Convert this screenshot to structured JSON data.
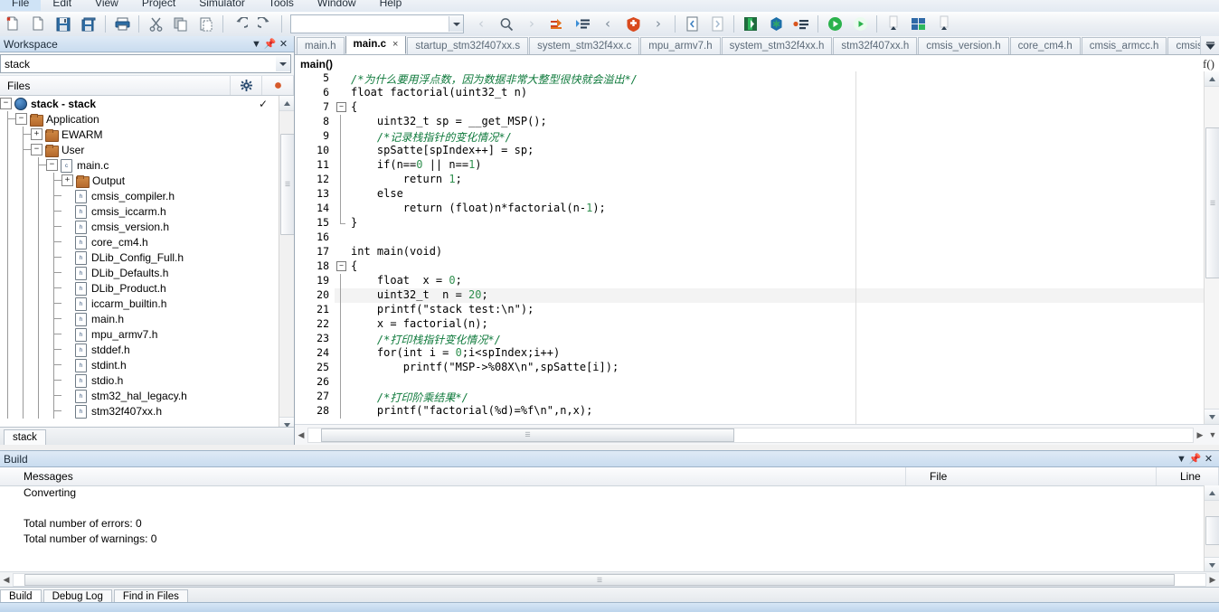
{
  "menu": {
    "items": [
      "File",
      "Edit",
      "View",
      "Project",
      "Simulator",
      "Tools",
      "Window",
      "Help"
    ]
  },
  "toolbar": {
    "combo_value": "",
    "buttons": [
      "new-document",
      "open-document",
      "save",
      "save-all",
      "print",
      "cut",
      "copy",
      "paste",
      "undo",
      "redo",
      "navigate-back",
      "find",
      "navigate-forward",
      "toggle-breakpoint",
      "bookmark",
      "previous-bookmark",
      "stop-build",
      "next-bookmark",
      "compile",
      "make",
      "download-and-debug",
      "debug-without-download",
      "make-and-restart",
      "go",
      "step",
      "sort",
      "stack-usage",
      "view-options"
    ]
  },
  "workspace": {
    "title": "Workspace",
    "controls": [
      "dropdown-icon",
      "pin-icon",
      "close-icon"
    ],
    "config_value": "stack",
    "columns": [
      "Files",
      "gear-icon",
      "dot-icon"
    ],
    "bottom_tab": "stack",
    "tree": [
      {
        "label": "stack - stack",
        "depth": 0,
        "expander": "-",
        "icon": "project",
        "bold": true,
        "check": "✓"
      },
      {
        "label": "Application",
        "depth": 1,
        "expander": "-",
        "icon": "folder",
        "bold": false,
        "check": ""
      },
      {
        "label": "EWARM",
        "depth": 2,
        "expander": "+",
        "icon": "folder",
        "bold": false,
        "check": ""
      },
      {
        "label": "User",
        "depth": 2,
        "expander": "-",
        "icon": "folder",
        "bold": false,
        "check": ""
      },
      {
        "label": "main.c",
        "depth": 3,
        "expander": "-",
        "icon": "c-file",
        "bold": false,
        "check": ""
      },
      {
        "label": "Output",
        "depth": 4,
        "expander": "+",
        "icon": "folder",
        "bold": false,
        "check": ""
      },
      {
        "label": "cmsis_compiler.h",
        "depth": 4,
        "expander": "",
        "icon": "h-file",
        "bold": false,
        "check": ""
      },
      {
        "label": "cmsis_iccarm.h",
        "depth": 4,
        "expander": "",
        "icon": "h-file",
        "bold": false,
        "check": ""
      },
      {
        "label": "cmsis_version.h",
        "depth": 4,
        "expander": "",
        "icon": "h-file",
        "bold": false,
        "check": ""
      },
      {
        "label": "core_cm4.h",
        "depth": 4,
        "expander": "",
        "icon": "h-file",
        "bold": false,
        "check": ""
      },
      {
        "label": "DLib_Config_Full.h",
        "depth": 4,
        "expander": "",
        "icon": "h-file",
        "bold": false,
        "check": ""
      },
      {
        "label": "DLib_Defaults.h",
        "depth": 4,
        "expander": "",
        "icon": "h-file",
        "bold": false,
        "check": ""
      },
      {
        "label": "DLib_Product.h",
        "depth": 4,
        "expander": "",
        "icon": "h-file",
        "bold": false,
        "check": ""
      },
      {
        "label": "iccarm_builtin.h",
        "depth": 4,
        "expander": "",
        "icon": "h-file",
        "bold": false,
        "check": ""
      },
      {
        "label": "main.h",
        "depth": 4,
        "expander": "",
        "icon": "h-file",
        "bold": false,
        "check": ""
      },
      {
        "label": "mpu_armv7.h",
        "depth": 4,
        "expander": "",
        "icon": "h-file",
        "bold": false,
        "check": ""
      },
      {
        "label": "stddef.h",
        "depth": 4,
        "expander": "",
        "icon": "h-file",
        "bold": false,
        "check": ""
      },
      {
        "label": "stdint.h",
        "depth": 4,
        "expander": "",
        "icon": "h-file",
        "bold": false,
        "check": ""
      },
      {
        "label": "stdio.h",
        "depth": 4,
        "expander": "",
        "icon": "h-file",
        "bold": false,
        "check": ""
      },
      {
        "label": "stm32_hal_legacy.h",
        "depth": 4,
        "expander": "",
        "icon": "h-file",
        "bold": false,
        "check": ""
      },
      {
        "label": "stm32f407xx.h",
        "depth": 4,
        "expander": "",
        "icon": "h-file",
        "bold": false,
        "check": ""
      }
    ]
  },
  "editor": {
    "tabs": [
      {
        "label": "main.h",
        "active": false
      },
      {
        "label": "main.c",
        "active": true
      },
      {
        "label": "startup_stm32f407xx.s",
        "active": false
      },
      {
        "label": "system_stm32f4xx.c",
        "active": false
      },
      {
        "label": "mpu_armv7.h",
        "active": false
      },
      {
        "label": "system_stm32f4xx.h",
        "active": false
      },
      {
        "label": "stm32f407xx.h",
        "active": false
      },
      {
        "label": "cmsis_version.h",
        "active": false
      },
      {
        "label": "core_cm4.h",
        "active": false
      },
      {
        "label": "cmsis_armcc.h",
        "active": false
      },
      {
        "label": "cmsis_iccarm.h",
        "active": false
      }
    ],
    "close_label": "×",
    "function_bar": "main()",
    "fx_icon": "f()",
    "overflow_icon": "chevron-down-icon",
    "lines": [
      {
        "n": 5,
        "fold": "bar-top",
        "current": false,
        "tokens": [
          {
            "t": "/*为什么要用浮点数，因为数据非常大整型很快就会溢出*/",
            "c": "cm"
          }
        ]
      },
      {
        "n": 6,
        "fold": "",
        "current": false,
        "tokens": [
          {
            "t": "float factorial(uint32_t n)",
            "c": ""
          }
        ]
      },
      {
        "n": 7,
        "fold": "box-minus",
        "current": false,
        "tokens": [
          {
            "t": "{",
            "c": ""
          }
        ]
      },
      {
        "n": 8,
        "fold": "bar",
        "current": false,
        "tokens": [
          {
            "t": "    uint32_t sp = __get_MSP();",
            "c": ""
          }
        ]
      },
      {
        "n": 9,
        "fold": "bar",
        "current": false,
        "tokens": [
          {
            "t": "    /*记录栈指针的变化情况*/",
            "c": "cm"
          }
        ]
      },
      {
        "n": 10,
        "fold": "bar",
        "current": false,
        "tokens": [
          {
            "t": "    spSatte[spIndex++] = sp;",
            "c": ""
          }
        ]
      },
      {
        "n": 11,
        "fold": "bar",
        "current": false,
        "tokens": [
          {
            "t": "    if(n==",
            "c": ""
          },
          {
            "t": "0",
            "c": "num"
          },
          {
            "t": " || n==",
            "c": ""
          },
          {
            "t": "1",
            "c": "num"
          },
          {
            "t": ")",
            "c": ""
          }
        ]
      },
      {
        "n": 12,
        "fold": "bar",
        "current": false,
        "tokens": [
          {
            "t": "        return ",
            "c": ""
          },
          {
            "t": "1",
            "c": "num"
          },
          {
            "t": ";",
            "c": ""
          }
        ]
      },
      {
        "n": 13,
        "fold": "bar",
        "current": false,
        "tokens": [
          {
            "t": "    else",
            "c": ""
          }
        ]
      },
      {
        "n": 14,
        "fold": "bar",
        "current": false,
        "tokens": [
          {
            "t": "        return (float)n*factorial(n-",
            "c": ""
          },
          {
            "t": "1",
            "c": "num"
          },
          {
            "t": ");",
            "c": ""
          }
        ]
      },
      {
        "n": 15,
        "fold": "bar-end",
        "current": false,
        "tokens": [
          {
            "t": "}",
            "c": ""
          }
        ]
      },
      {
        "n": 16,
        "fold": "",
        "current": false,
        "tokens": [
          {
            "t": "",
            "c": ""
          }
        ]
      },
      {
        "n": 17,
        "fold": "",
        "current": false,
        "tokens": [
          {
            "t": "int main(void)",
            "c": ""
          }
        ]
      },
      {
        "n": 18,
        "fold": "box-minus",
        "current": false,
        "tokens": [
          {
            "t": "{",
            "c": ""
          }
        ]
      },
      {
        "n": 19,
        "fold": "bar",
        "current": false,
        "tokens": [
          {
            "t": "    float  x = ",
            "c": ""
          },
          {
            "t": "0",
            "c": "num"
          },
          {
            "t": ";",
            "c": ""
          }
        ]
      },
      {
        "n": 20,
        "fold": "bar",
        "current": true,
        "tokens": [
          {
            "t": "    uint32_t  n = ",
            "c": ""
          },
          {
            "t": "20",
            "c": "num"
          },
          {
            "t": ";",
            "c": ""
          }
        ]
      },
      {
        "n": 21,
        "fold": "bar",
        "current": false,
        "tokens": [
          {
            "t": "    printf(\"stack test:\\n\");",
            "c": ""
          }
        ]
      },
      {
        "n": 22,
        "fold": "bar",
        "current": false,
        "tokens": [
          {
            "t": "    x = factorial(n);",
            "c": ""
          }
        ]
      },
      {
        "n": 23,
        "fold": "bar",
        "current": false,
        "tokens": [
          {
            "t": "    /*打印栈指针变化情况*/",
            "c": "cm"
          }
        ]
      },
      {
        "n": 24,
        "fold": "bar",
        "current": false,
        "tokens": [
          {
            "t": "    for(int i = ",
            "c": ""
          },
          {
            "t": "0",
            "c": "num"
          },
          {
            "t": ";i<spIndex;i++)",
            "c": ""
          }
        ]
      },
      {
        "n": 25,
        "fold": "bar",
        "current": false,
        "tokens": [
          {
            "t": "        printf(\"MSP->%08X\\n\",spSatte[i]);",
            "c": ""
          }
        ]
      },
      {
        "n": 26,
        "fold": "bar",
        "current": false,
        "tokens": [
          {
            "t": "",
            "c": ""
          }
        ]
      },
      {
        "n": 27,
        "fold": "bar",
        "current": false,
        "tokens": [
          {
            "t": "    /*打印阶乘结果*/",
            "c": "cm"
          }
        ]
      },
      {
        "n": 28,
        "fold": "bar",
        "current": false,
        "tokens": [
          {
            "t": "    printf(\"factorial(%d)=%f\\n\",n,x);",
            "c": ""
          }
        ]
      }
    ]
  },
  "build": {
    "title": "Build",
    "controls": [
      "dropdown-icon",
      "pin-icon",
      "close-icon"
    ],
    "columns": [
      "Messages",
      "File",
      "Line"
    ],
    "messages": [
      "Converting",
      "",
      "Total number of errors: 0",
      "Total number of warnings: 0"
    ]
  },
  "bottom_tabs": [
    {
      "label": "Build",
      "active": true
    },
    {
      "label": "Debug Log",
      "active": false
    },
    {
      "label": "Find in Files",
      "active": false
    }
  ]
}
